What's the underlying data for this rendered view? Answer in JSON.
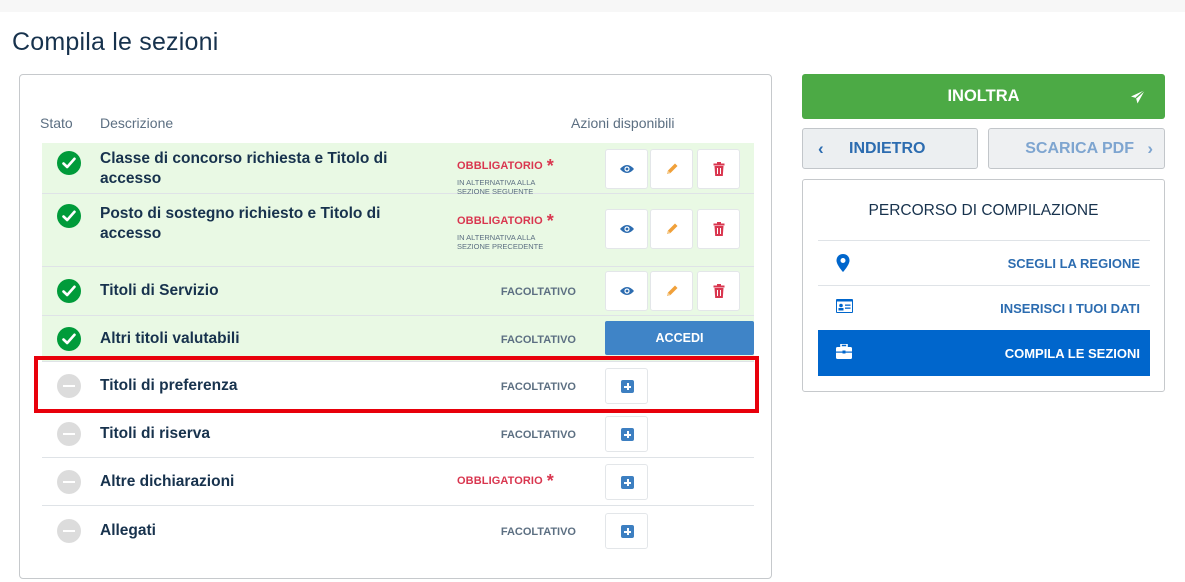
{
  "page": {
    "title": "Compila le sezioni"
  },
  "table": {
    "headers": {
      "stato": "Stato",
      "descrizione": "Descrizione",
      "azioni": "Azioni disponibili"
    },
    "rows": [
      {
        "label": "Classe di concorso richiesta e Titolo di accesso",
        "status": "complete",
        "requirement": "OBBLIGATORIO",
        "note": "IN ALTERNATIVA ALLA SEZIONE SEGUENTE",
        "actions": [
          "view",
          "edit",
          "delete"
        ]
      },
      {
        "label": "Posto di sostegno richiesto e Titolo di accesso",
        "status": "complete",
        "requirement": "OBBLIGATORIO",
        "note": "IN ALTERNATIVA ALLA SEZIONE PRECEDENTE",
        "actions": [
          "view",
          "edit",
          "delete"
        ]
      },
      {
        "label": "Titoli di Servizio",
        "status": "complete",
        "requirement": "FACOLTATIVO",
        "actions": [
          "view",
          "edit",
          "delete"
        ]
      },
      {
        "label": "Altri titoli valutabili",
        "status": "complete",
        "requirement": "FACOLTATIVO",
        "action_label": "ACCEDI"
      },
      {
        "label": "Titoli di preferenza",
        "status": "empty",
        "requirement": "FACOLTATIVO",
        "actions": [
          "add"
        ],
        "highlighted": true
      },
      {
        "label": "Titoli di riserva",
        "status": "empty",
        "requirement": "FACOLTATIVO",
        "actions": [
          "add"
        ]
      },
      {
        "label": "Altre dichiarazioni",
        "status": "empty",
        "requirement": "OBBLIGATORIO",
        "actions": [
          "add"
        ]
      },
      {
        "label": "Allegati",
        "status": "empty",
        "requirement": "FACOLTATIVO",
        "actions": [
          "add"
        ]
      }
    ],
    "required_marker": "*"
  },
  "sidebar": {
    "inoltra_label": "INOLTRA",
    "indietro_label": "INDIETRO",
    "scarica_label": "SCARICA PDF",
    "percorso_title": "PERCORSO DI COMPILAZIONE",
    "steps": [
      {
        "label": "SCEGLI LA REGIONE",
        "icon": "map-marker-icon"
      },
      {
        "label": "INSERISCI I TUOI DATI",
        "icon": "id-card-icon"
      },
      {
        "label": "COMPILA LE SEZIONI",
        "icon": "briefcase-icon",
        "active": true
      }
    ]
  },
  "colors": {
    "primary": "#0066cc",
    "success": "#4caa45",
    "required": "#d9364f",
    "highlight": "#e8000b",
    "done_row": "#e9f9e4"
  }
}
